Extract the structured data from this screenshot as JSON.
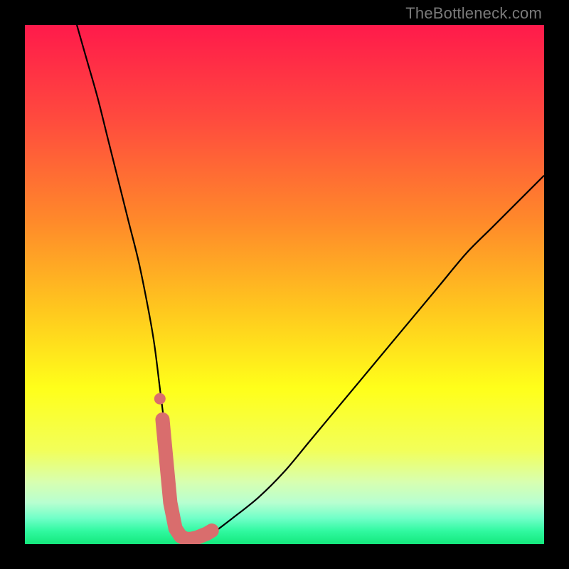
{
  "watermark": "TheBottleneck.com",
  "colors": {
    "black": "#000000",
    "watermark_text": "#7a7a7a",
    "curve_stroke": "#000000",
    "marker_fill": "#d96d6d",
    "gradient_stops": [
      {
        "offset": 0.0,
        "color": "#ff1a4b"
      },
      {
        "offset": 0.18,
        "color": "#ff4a3e"
      },
      {
        "offset": 0.38,
        "color": "#ff8a2a"
      },
      {
        "offset": 0.55,
        "color": "#ffc81e"
      },
      {
        "offset": 0.7,
        "color": "#ffff1a"
      },
      {
        "offset": 0.82,
        "color": "#f2ff5a"
      },
      {
        "offset": 0.88,
        "color": "#d8ffb0"
      },
      {
        "offset": 0.92,
        "color": "#b8ffd0"
      },
      {
        "offset": 0.95,
        "color": "#70ffc8"
      },
      {
        "offset": 0.975,
        "color": "#30f9a0"
      },
      {
        "offset": 1.0,
        "color": "#14e87c"
      }
    ]
  },
  "chart_data": {
    "type": "line",
    "title": "",
    "xlabel": "",
    "ylabel": "",
    "xlim": [
      0,
      100
    ],
    "ylim": [
      0,
      100
    ],
    "grid": false,
    "legend": false,
    "series": [
      {
        "name": "bottleneck-curve",
        "x": [
          10,
          12,
          14,
          16,
          18,
          20,
          22,
          24,
          25,
          26,
          27,
          28,
          29,
          30,
          31,
          32,
          34,
          36,
          40,
          45,
          50,
          55,
          60,
          65,
          70,
          75,
          80,
          85,
          90,
          95,
          100
        ],
        "values": [
          100,
          93,
          86,
          78,
          70,
          62,
          54,
          44,
          38,
          30,
          22,
          14,
          6,
          2,
          1,
          1,
          1,
          2,
          5,
          9,
          14,
          20,
          26,
          32,
          38,
          44,
          50,
          56,
          61,
          66,
          71
        ]
      }
    ],
    "markers": {
      "name": "highlight-segment",
      "x": [
        26.5,
        28.0,
        29.0,
        30.0,
        31.0,
        32.0,
        33.0,
        34.0,
        35.0,
        36.0
      ],
      "values": [
        24.0,
        8.0,
        3.0,
        1.5,
        1.0,
        1.0,
        1.2,
        1.6,
        2.0,
        2.6
      ],
      "dot": {
        "x": 26.0,
        "value": 28.0
      }
    }
  }
}
